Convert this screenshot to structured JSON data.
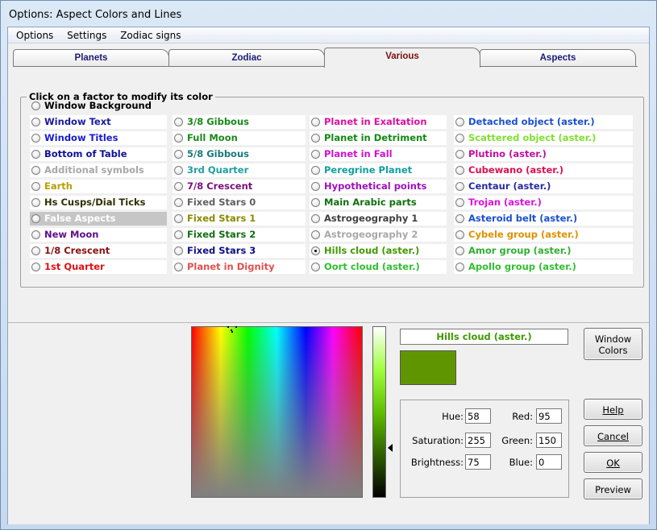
{
  "window": {
    "title": "Options: Aspect Colors and Lines"
  },
  "menu": [
    "Options",
    "Settings",
    "Zodiac signs"
  ],
  "tabs": [
    {
      "label": "Planets",
      "active": false
    },
    {
      "label": "Zodiac",
      "active": false
    },
    {
      "label": "Various",
      "active": true
    },
    {
      "label": "Aspects",
      "active": false
    }
  ],
  "group": {
    "title": "Click on a factor to modify its color"
  },
  "header_factor": {
    "label": "Window Background",
    "color": "#000000"
  },
  "columns": [
    [
      {
        "label": "Window Text",
        "color": "#1a1aa0"
      },
      {
        "label": "Window Titles",
        "color": "#1a1ad0"
      },
      {
        "label": "Bottom of Table",
        "color": "#10109a"
      },
      {
        "label": "Additional symbols",
        "color": "#a8a8a8"
      },
      {
        "label": "Earth",
        "color": "#b8a000"
      },
      {
        "label": "Hs Cusps/Dial Ticks",
        "color": "#303000"
      },
      {
        "label": "False Aspects",
        "color": "#ffffff",
        "selected": true
      },
      {
        "label": "New Moon",
        "color": "#60108a"
      },
      {
        "label": "1/8 Crescent",
        "color": "#8a1010"
      },
      {
        "label": "1st Quarter",
        "color": "#e01010"
      }
    ],
    [
      {
        "label": "3/8 Gibbous",
        "color": "#1a8a1a"
      },
      {
        "label": "Full Moon",
        "color": "#1a8a1a"
      },
      {
        "label": "5/8 Gibbous",
        "color": "#1a7a7a"
      },
      {
        "label": "3rd Quarter",
        "color": "#20a0a0"
      },
      {
        "label": "7/8 Crescent",
        "color": "#7a107a"
      },
      {
        "label": "Fixed Stars 0",
        "color": "#606060"
      },
      {
        "label": "Fixed Stars 1",
        "color": "#8a8a00"
      },
      {
        "label": "Fixed Stars 2",
        "color": "#107010"
      },
      {
        "label": "Fixed Stars 3",
        "color": "#10108a"
      },
      {
        "label": "Planet in Dignity",
        "color": "#e05050"
      }
    ],
    [
      {
        "label": "Planet in Exaltation",
        "color": "#e010a0"
      },
      {
        "label": "Planet in Detriment",
        "color": "#108a10"
      },
      {
        "label": "Planet in Fall",
        "color": "#d010d0"
      },
      {
        "label": "Peregrine Planet",
        "color": "#10a0a0"
      },
      {
        "label": "Hypothetical points",
        "color": "#a010c0"
      },
      {
        "label": "Main Arabic parts",
        "color": "#107010"
      },
      {
        "label": "Astrogeography 1",
        "color": "#404040"
      },
      {
        "label": "Astrogeography 2",
        "color": "#a8a8a8"
      },
      {
        "label": "Hills cloud (aster.)",
        "color": "#409a00",
        "checked": true
      },
      {
        "label": "Oort cloud (aster.)",
        "color": "#30c030"
      }
    ],
    [
      {
        "label": "Detached object (aster.)",
        "color": "#1a50d0"
      },
      {
        "label": "Scattered object (aster.)",
        "color": "#80e030"
      },
      {
        "label": "Plutino (aster.)",
        "color": "#c010a0"
      },
      {
        "label": "Cubewano (aster.)",
        "color": "#e01050"
      },
      {
        "label": "Centaur (aster.)",
        "color": "#2a2aa0"
      },
      {
        "label": "Trojan (aster.)",
        "color": "#e010e0"
      },
      {
        "label": "Asteroid belt (aster.)",
        "color": "#1a50d0"
      },
      {
        "label": "Cybele group (aster.)",
        "color": "#e09000"
      },
      {
        "label": "Amor group (aster.)",
        "color": "#30b030"
      },
      {
        "label": "Apollo group (aster.)",
        "color": "#30c030"
      }
    ]
  ],
  "picker": {
    "selected_name": "Hills cloud (aster.)",
    "selected_name_color": "#409a00",
    "swatch_color": "#5f9600",
    "fields": {
      "hue": {
        "label": "Hue:",
        "value": "58"
      },
      "saturation": {
        "label": "Saturation:",
        "value": "255"
      },
      "brightness": {
        "label": "Brightness:",
        "value": "75"
      },
      "red": {
        "label": "Red:",
        "value": "95"
      },
      "green": {
        "label": "Green:",
        "value": "150"
      },
      "blue": {
        "label": "Blue:",
        "value": "0"
      }
    }
  },
  "buttons": {
    "window_colors_1": "Window",
    "window_colors_2": "Colors",
    "help": "Help",
    "cancel": "Cancel",
    "ok": "OK",
    "preview": "Preview"
  }
}
